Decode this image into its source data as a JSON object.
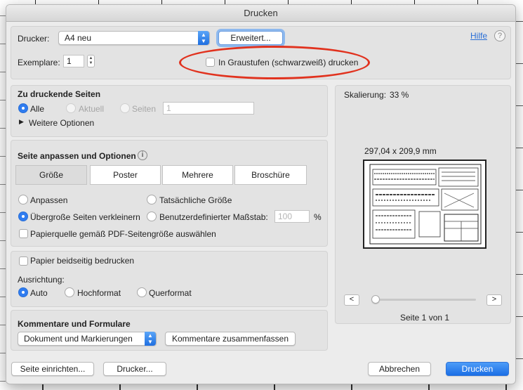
{
  "window": {
    "title": "Drucken"
  },
  "printer": {
    "label": "Drucker:",
    "selected": "A4 neu",
    "advanced_button": "Erweitert...",
    "help_link": "Hilfe",
    "help_icon": "?"
  },
  "copies": {
    "label": "Exemplare:",
    "value": "1",
    "grayscale_label": "In Graustufen (schwarzweiß) drucken",
    "grayscale_checked": false
  },
  "pages_to_print": {
    "title": "Zu druckende Seiten",
    "options": [
      "Alle",
      "Aktuell",
      "Seiten"
    ],
    "selected": "Alle",
    "pages_value": "1",
    "more_options": "Weitere Optionen"
  },
  "page_sizing": {
    "title": "Seite anpassen und Optionen",
    "info_icon": "i",
    "tabs": [
      "Größe",
      "Poster",
      "Mehrere",
      "Broschüre"
    ],
    "selected_tab": "Größe",
    "fit": "Anpassen",
    "actual_size": "Tatsächliche Größe",
    "shrink_oversized": "Übergroße Seiten verkleinern",
    "custom_scale": "Benutzerdefinierter Maßstab:",
    "custom_scale_value": "100",
    "percent": "%",
    "selected_option": "Übergroße Seiten verkleinern",
    "paper_source": "Papierquelle gemäß PDF-Seitengröße auswählen"
  },
  "duplex": {
    "label": "Papier beidseitig bedrucken",
    "orientation_label": "Ausrichtung:",
    "options": [
      "Auto",
      "Hochformat",
      "Querformat"
    ],
    "selected": "Auto"
  },
  "comments": {
    "title": "Kommentare und Formulare",
    "selected": "Dokument und Markierungen",
    "summarize_button": "Kommentare zusammenfassen"
  },
  "preview": {
    "scaling_label": "Skalierung:",
    "scaling_value": "33 %",
    "page_size": "297,04 x 209,9 mm",
    "page_indicator": "Seite 1 von 1",
    "prev": "<",
    "next": ">"
  },
  "footer": {
    "page_setup": "Seite einrichten...",
    "printer": "Drucker...",
    "cancel": "Abbrechen",
    "print": "Drucken"
  },
  "colors": {
    "accent": "#2f7cf0",
    "annotation": "#e1321e"
  }
}
